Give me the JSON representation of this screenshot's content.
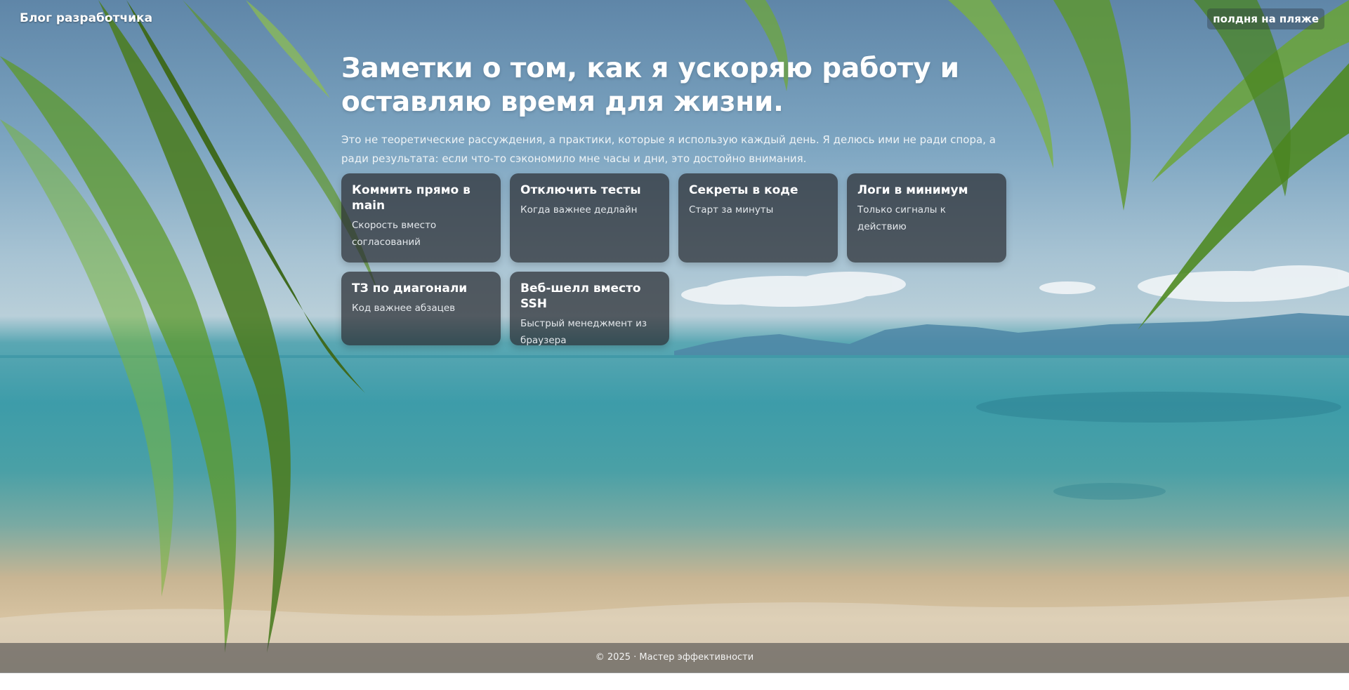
{
  "header": {
    "brand": "Блог разработчика",
    "theme_button": "полдня на пляже"
  },
  "hero": {
    "title": "Заметки о том, как я ускоряю работу и оставляю время для жизни.",
    "lead": "Это не теоретические рассуждения, а практики, которые я использую каждый день. Я делюсь ими не ради спора, а ради результата: если что-то сэкономило мне часы и дни, это достойно внимания."
  },
  "cards": [
    {
      "title": "Коммить прямо в main",
      "subtitle": "Скорость вместо согласований"
    },
    {
      "title": "Отключить тесты",
      "subtitle": "Когда важнее дедлайн"
    },
    {
      "title": "Секреты в коде",
      "subtitle": "Старт за минуты"
    },
    {
      "title": "Логи в минимум",
      "subtitle": "Только сигналы к действию"
    },
    {
      "title": "ТЗ по диагонали",
      "subtitle": "Код важнее абзацев"
    },
    {
      "title": "Веб-шелл вместо SSH",
      "subtitle": "Быстрый менеджмент из браузера"
    }
  ],
  "footer": {
    "text": "© 2025 · Мастер эффективности"
  },
  "colors": {
    "card_bg": "#2a2c32",
    "sky": "#6f95b3",
    "sea": "#3d9ca9",
    "sand": "#d7c3a1"
  }
}
